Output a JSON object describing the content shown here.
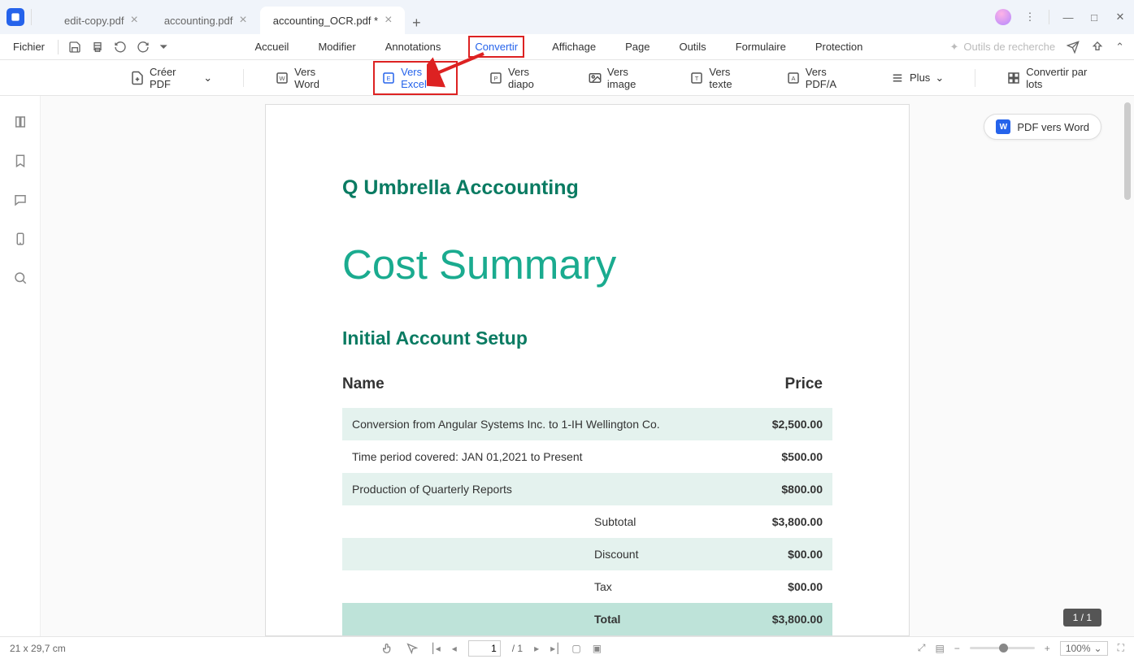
{
  "tabs": [
    {
      "label": "edit-copy.pdf"
    },
    {
      "label": "accounting.pdf"
    },
    {
      "label": "accounting_OCR.pdf *"
    }
  ],
  "menubar": {
    "file": "Fichier",
    "items": [
      "Accueil",
      "Modifier",
      "Annotations",
      "Convertir",
      "Affichage",
      "Page",
      "Outils",
      "Formulaire",
      "Protection"
    ],
    "search": "Outils de recherche"
  },
  "toolbar": {
    "create": "Créer PDF",
    "word": "Vers Word",
    "excel": "Vers Excel",
    "diapo": "Vers diapo",
    "image": "Vers image",
    "texte": "Vers texte",
    "pdfa": "Vers PDF/A",
    "plus": "Plus",
    "batch": "Convertir par lots"
  },
  "float_button": "PDF vers Word",
  "document": {
    "logo": "Q Umbrella Acccounting",
    "title": "Cost Summary",
    "subtitle": "Initial Account Setup",
    "columns": {
      "name": "Name",
      "price": "Price"
    },
    "rows": [
      {
        "name": "Conversion from Angular Systems Inc. to 1-IH Wellington Co.",
        "price": "$2,500.00"
      },
      {
        "name": "Time period covered: JAN 01,2021 to Present",
        "price": "$500.00"
      },
      {
        "name": "Production of Quarterly Reports",
        "price": "$800.00"
      }
    ],
    "summary": [
      {
        "label": "Subtotal",
        "value": "$3,800.00"
      },
      {
        "label": "Discount",
        "value": "$00.00"
      },
      {
        "label": "Tax",
        "value": "$00.00"
      },
      {
        "label": "Total",
        "value": "$3,800.00"
      }
    ]
  },
  "page_badge": "1 / 1",
  "status": {
    "dims": "21 x 29,7 cm",
    "page_current": "1",
    "page_total": "/ 1",
    "zoom": "100%"
  }
}
